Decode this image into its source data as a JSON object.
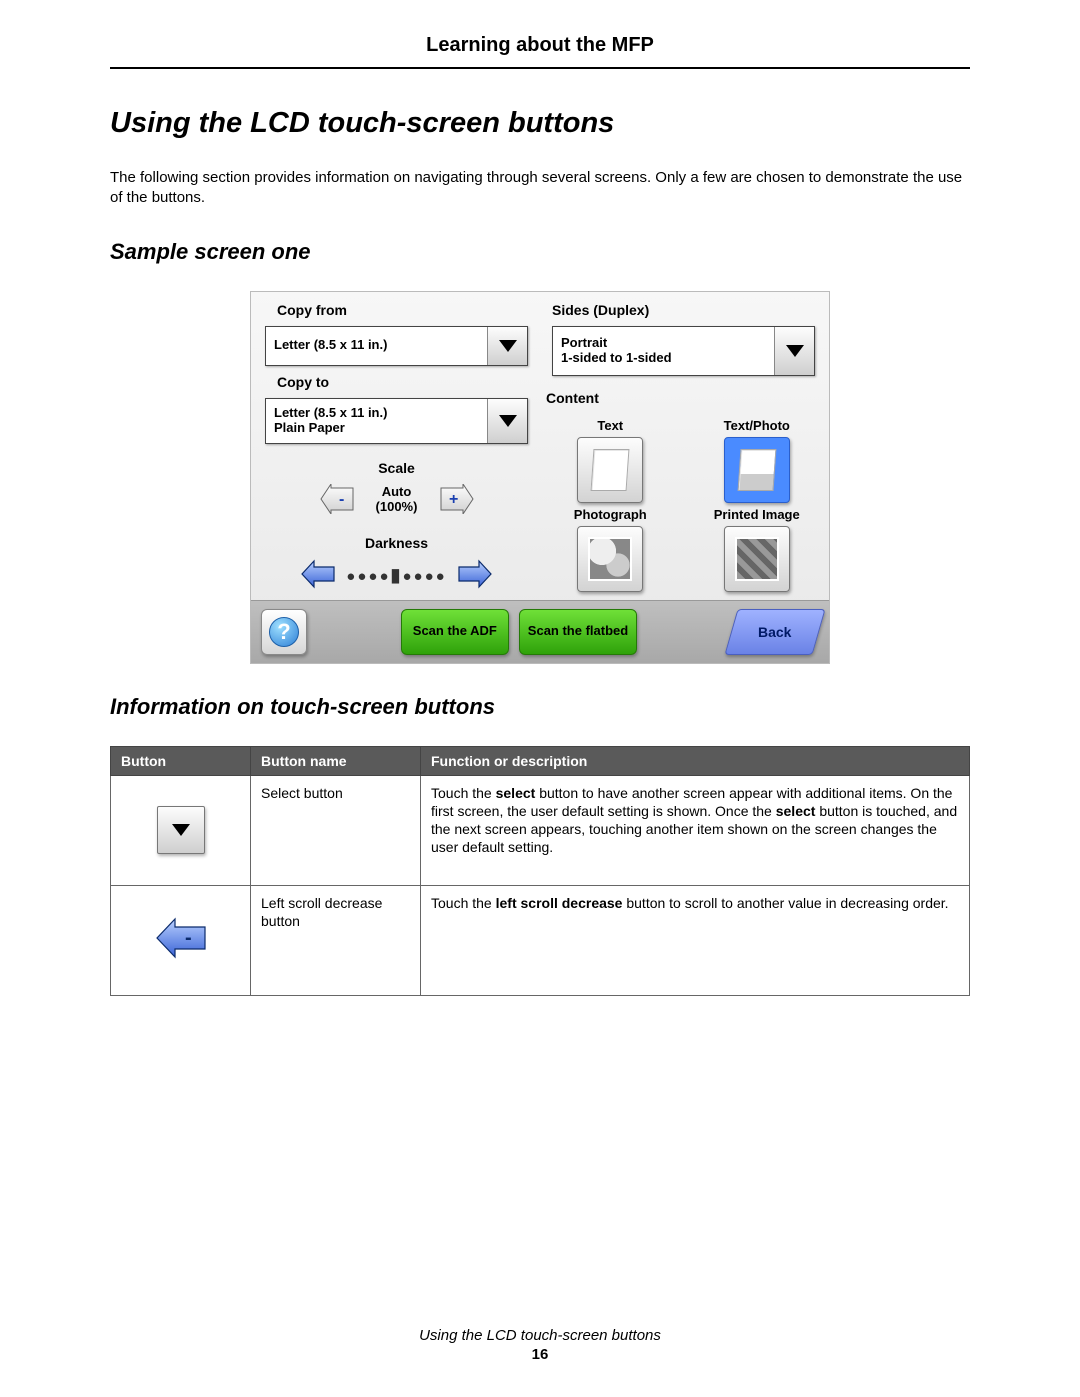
{
  "page": {
    "header": "Learning about the MFP",
    "title": "Using the LCD touch-screen buttons",
    "intro": "The following section provides information on navigating through several screens. Only a few are chosen to demonstrate the use of the buttons.",
    "section1": "Sample screen one",
    "section2": "Information on touch-screen buttons",
    "footer_title": "Using the LCD touch-screen buttons",
    "footer_page": "16"
  },
  "lcd": {
    "copy_from_label": "Copy from",
    "copy_from_value": "Letter (8.5 x 11 in.)",
    "copy_to_label": "Copy to",
    "copy_to_value_line1": "Letter (8.5 x 11 in.)",
    "copy_to_value_line2": "Plain Paper",
    "scale_label": "Scale",
    "scale_value_line1": "Auto",
    "scale_value_line2": "(100%)",
    "darkness_label": "Darkness",
    "sides_label": "Sides (Duplex)",
    "sides_value_line1": "Portrait",
    "sides_value_line2": "1-sided to 1-sided",
    "content_label": "Content",
    "content_items": {
      "c0": "Text",
      "c1": "Text/Photo",
      "c2": "Photograph",
      "c3": "Printed Image"
    },
    "scan_adf": "Scan the ADF",
    "scan_flatbed": "Scan the flatbed",
    "back": "Back"
  },
  "table": {
    "h0": "Button",
    "h1": "Button name",
    "h2": "Function or description",
    "rows": [
      {
        "name": "Select button",
        "desc_pre": "Touch the ",
        "desc_b1": "select",
        "desc_mid": " button to have another screen appear with additional items. On the first screen, the user default setting is shown. Once the ",
        "desc_b2": "select",
        "desc_post": " button is touched, and the next screen appears, touching another item shown on the screen changes the user default setting."
      },
      {
        "name": "Left scroll decrease button",
        "desc_pre": "Touch the ",
        "desc_b1": "left scroll decrease",
        "desc_mid": " button to scroll to another value in decreasing order.",
        "desc_b2": "",
        "desc_post": ""
      }
    ]
  }
}
